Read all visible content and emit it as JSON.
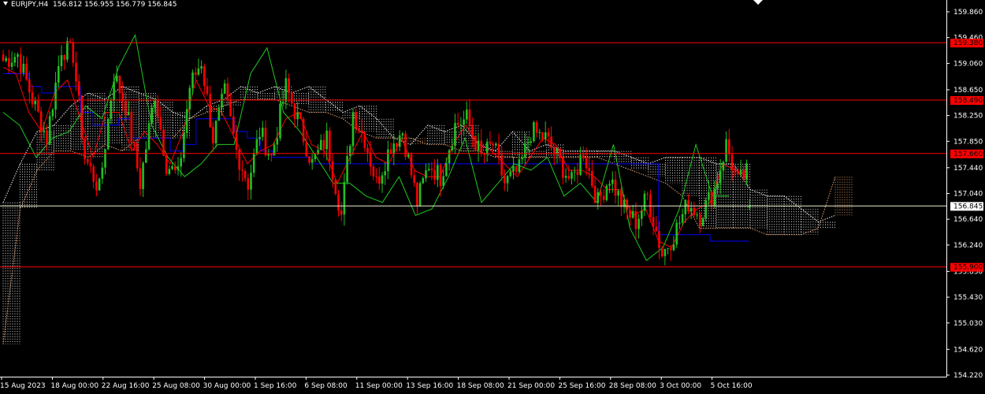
{
  "header": {
    "symbol_timeframe": "EURJPY,H4",
    "quote": "156.812 156.955 156.779 156.845"
  },
  "colors": {
    "background": "#000000",
    "bull_candle": "#22c022",
    "bear_candle": "#ff0000",
    "horizontal_line": "#ff0000",
    "bid_line": "#e6e6c8",
    "tenkan": "#ff0000",
    "kijun": "#0000ff",
    "chikou": "#1fc81f",
    "cloud_a": "#f0f0f0",
    "cloud_b": "#e8a070"
  },
  "chart_data": {
    "type": "candlestick",
    "symbol": "EURJPY",
    "timeframe": "H4",
    "ohlc_current": {
      "open": 156.812,
      "high": 156.955,
      "low": 156.779,
      "close": 156.845
    },
    "ylim": [
      154.22,
      160.08
    ],
    "y_ticks": [
      "159.860",
      "159.460",
      "159.060",
      "158.650",
      "158.250",
      "157.850",
      "157.440",
      "157.040",
      "156.640",
      "156.240",
      "155.830",
      "155.430",
      "155.030",
      "154.620",
      "154.220"
    ],
    "x_ticks": [
      "15 Aug 2023",
      "18 Aug 00:00",
      "22 Aug 16:00",
      "25 Aug 08:00",
      "30 Aug 00:00",
      "1 Sep 16:00",
      "6 Sep 08:00",
      "11 Sep 00:00",
      "13 Sep 16:00",
      "18 Sep 08:00",
      "21 Sep 00:00",
      "25 Sep 16:00",
      "28 Sep 08:00",
      "3 Oct 00:00",
      "5 Oct 16:00"
    ],
    "horizontal_lines": [
      {
        "value": 159.38,
        "label": "159.380"
      },
      {
        "value": 158.49,
        "label": "158.490"
      },
      {
        "value": 157.66,
        "label": "157.660"
      },
      {
        "value": 155.9,
        "label": "155.900"
      }
    ],
    "current_price": {
      "value": 156.845,
      "label": "156.845"
    },
    "grid": false,
    "price_path": [
      [
        0,
        159.1
      ],
      [
        5,
        159.2
      ],
      [
        10,
        158.5
      ],
      [
        15,
        157.9
      ],
      [
        20,
        159.3
      ],
      [
        24,
        159.2
      ],
      [
        28,
        157.6
      ],
      [
        33,
        157.1
      ],
      [
        38,
        158.9
      ],
      [
        42,
        158.4
      ],
      [
        47,
        157.2
      ],
      [
        52,
        158.6
      ],
      [
        56,
        157.5
      ],
      [
        60,
        157.3
      ],
      [
        64,
        158.7
      ],
      [
        68,
        159.1
      ],
      [
        72,
        157.9
      ],
      [
        76,
        158.6
      ],
      [
        80,
        157.7
      ],
      [
        84,
        157.2
      ],
      [
        88,
        158.0
      ],
      [
        92,
        157.6
      ],
      [
        97,
        158.7
      ],
      [
        101,
        158.2
      ],
      [
        106,
        157.5
      ],
      [
        111,
        157.9
      ],
      [
        116,
        156.7
      ],
      [
        120,
        158.3
      ],
      [
        124,
        157.9
      ],
      [
        128,
        157.2
      ],
      [
        133,
        157.8
      ],
      [
        137,
        158.0
      ],
      [
        142,
        156.9
      ],
      [
        146,
        157.5
      ],
      [
        150,
        157.3
      ],
      [
        155,
        158.1
      ],
      [
        159,
        158.2
      ],
      [
        164,
        157.6
      ],
      [
        168,
        157.8
      ],
      [
        172,
        157.2
      ],
      [
        177,
        157.4
      ],
      [
        181,
        158.0
      ],
      [
        186,
        157.9
      ],
      [
        190,
        157.6
      ],
      [
        195,
        157.2
      ],
      [
        199,
        157.7
      ],
      [
        204,
        156.9
      ],
      [
        208,
        157.3
      ],
      [
        213,
        156.8
      ],
      [
        217,
        156.6
      ],
      [
        221,
        157.0
      ],
      [
        226,
        156.1
      ],
      [
        230,
        156.4
      ],
      [
        235,
        156.9
      ],
      [
        239,
        156.7
      ],
      [
        244,
        157.1
      ],
      [
        248,
        157.8
      ],
      [
        252,
        157.2
      ],
      [
        256,
        157.4
      ]
    ],
    "indicators": [
      {
        "name": "Tenkan-sen",
        "values": [
          159.0,
          158.9,
          158.3,
          158.0,
          158.6,
          158.8,
          158.2,
          157.6,
          158.3,
          158.3,
          157.7,
          158.0,
          157.8,
          157.5,
          158.0,
          158.8,
          158.4,
          158.3,
          157.9,
          157.5,
          157.7,
          157.8,
          158.2,
          158.3,
          157.8,
          157.7,
          157.2,
          157.6,
          158.0,
          157.6,
          157.5,
          157.9,
          157.4,
          157.3,
          157.3,
          157.8,
          158.1,
          157.8,
          157.7,
          157.5,
          157.3,
          157.6,
          157.9,
          157.8,
          157.4,
          157.4,
          157.3,
          157.1,
          157.1,
          156.7,
          156.8,
          156.3,
          156.2,
          156.6,
          156.8,
          156.9,
          157.5,
          157.4,
          157.3
        ]
      },
      {
        "name": "Kijun-sen",
        "values": [
          158.9,
          158.9,
          158.7,
          158.6,
          158.7,
          158.7,
          158.3,
          158.1,
          158.1,
          158.2,
          157.9,
          157.9,
          157.9,
          157.7,
          157.8,
          158.2,
          158.2,
          158.2,
          158.0,
          157.9,
          157.7,
          157.6,
          157.6,
          157.6,
          157.5,
          157.5,
          157.5,
          157.5,
          157.5,
          157.5,
          157.5,
          157.5,
          157.5,
          157.5,
          157.5,
          157.5,
          157.5,
          157.5,
          157.5,
          157.5,
          157.5,
          157.5,
          157.5,
          157.5,
          157.5,
          157.5,
          157.5,
          157.5,
          157.5,
          157.5,
          157.5,
          156.4,
          156.4,
          156.4,
          156.4,
          156.3,
          156.3,
          156.3,
          156.3
        ]
      },
      {
        "name": "Chikou Span",
        "values": [
          158.3,
          158.1,
          157.6,
          157.9,
          158.0,
          158.4,
          158.2,
          159.0,
          159.5,
          158.1,
          157.6,
          157.3,
          157.5,
          157.8,
          157.8,
          158.9,
          159.3,
          158.3,
          158.0,
          157.6,
          157.2,
          157.2,
          157.0,
          156.9,
          157.3,
          156.7,
          156.8,
          157.3,
          157.9,
          156.9,
          157.2,
          157.5,
          157.4,
          157.6,
          157.0,
          157.2,
          156.9,
          157.8,
          156.5,
          156.0,
          156.2,
          156.8,
          157.8,
          157.0,
          157.0
        ]
      },
      {
        "name": "Senkou Span A",
        "values": [
          156.9,
          157.5,
          158.0,
          158.1,
          158.4,
          158.6,
          158.5,
          158.7,
          158.6,
          158.5,
          158.3,
          158.2,
          158.4,
          158.5,
          158.7,
          158.6,
          158.7,
          158.6,
          158.7,
          158.5,
          158.3,
          158.4,
          158.2,
          157.9,
          157.8,
          158.1,
          158.0,
          158.1,
          157.8,
          157.7,
          158.0,
          157.7,
          157.8,
          157.7,
          157.7,
          157.7,
          157.7,
          157.6,
          157.5,
          157.6,
          157.6,
          157.6,
          157.5,
          157.5,
          157.1,
          157.0,
          157.0,
          156.8,
          156.6,
          156.7
        ]
      },
      {
        "name": "Senkou Span B",
        "values": [
          154.7,
          156.8,
          157.4,
          157.7,
          157.7,
          157.6,
          157.8,
          157.7,
          157.9,
          157.9,
          157.9,
          158.2,
          158.3,
          158.4,
          158.5,
          158.5,
          158.5,
          158.4,
          158.3,
          158.3,
          158.2,
          158.0,
          157.9,
          157.9,
          157.9,
          157.8,
          157.8,
          157.7,
          157.7,
          157.6,
          157.6,
          157.6,
          157.6,
          157.6,
          157.6,
          157.6,
          157.5,
          157.4,
          157.3,
          157.2,
          157.0,
          156.5,
          156.5,
          156.5,
          156.5,
          156.4,
          156.4,
          156.4,
          156.5,
          157.3
        ]
      }
    ]
  }
}
